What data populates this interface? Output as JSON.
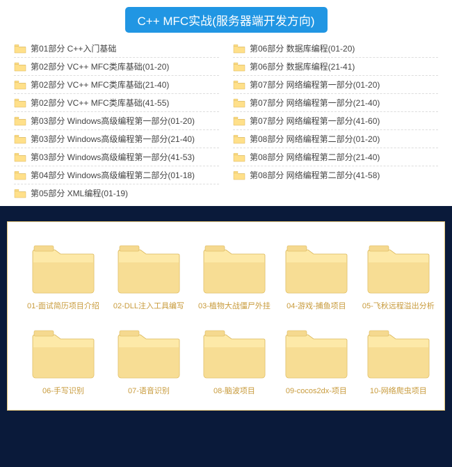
{
  "title": "C++ MFC实战(服务器端开发方向)",
  "listLeft": [
    "第01部分 C++入门基础",
    "第02部分 VC++ MFC类库基础(01-20)",
    "第02部分 VC++ MFC类库基础(21-40)",
    "第02部分 VC++ MFC类库基础(41-55)",
    "第03部分 Windows高级编程第一部分(01-20)",
    "第03部分 Windows高级编程第一部分(21-40)",
    "第03部分 Windows高级编程第一部分(41-53)",
    "第04部分 Windows高级编程第二部分(01-18)",
    "第05部分 XML编程(01-19)"
  ],
  "listRight": [
    "第06部分 数据库编程(01-20)",
    "第06部分 数据库编程(21-41)",
    "第07部分 网络编程第一部分(01-20)",
    "第07部分 网络编程第一部分(21-40)",
    "第07部分 网络编程第一部分(41-60)",
    "第08部分 网络编程第二部分(01-20)",
    "第08部分 网络编程第二部分(21-40)",
    "第08部分 网络编程第二部分(41-58)"
  ],
  "gridItems": [
    "01-面试简历项目介绍",
    "02-DLL注入工具编写",
    "03-植物大战僵尸外挂",
    "04-游戏-捕鱼项目",
    "05-飞秋远程溢出分析",
    "06-手写识别",
    "07-语音识别",
    "08-脑波项目",
    "09-cocos2dx-项目",
    "10-网络爬虫项目"
  ],
  "colors": {
    "folderLight": "#fde9a8",
    "folderDark": "#f3d484",
    "folderTab": "#f5d98f"
  }
}
